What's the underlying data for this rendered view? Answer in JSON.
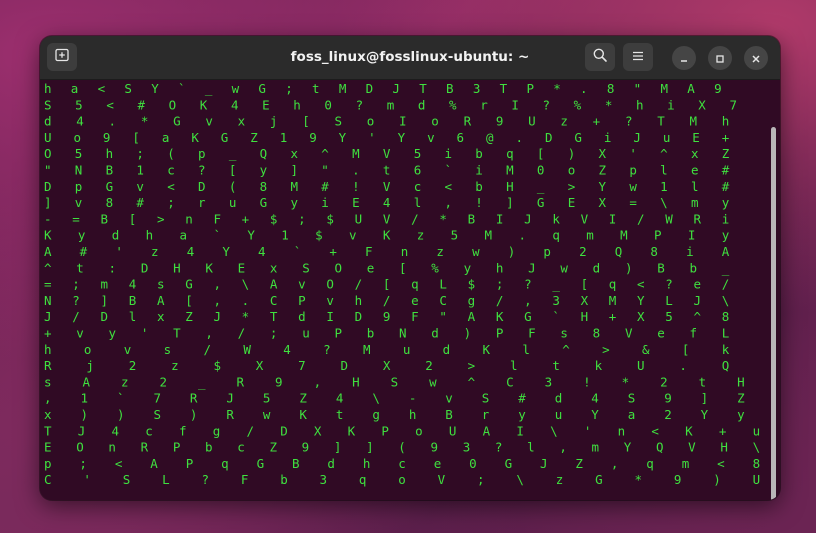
{
  "window": {
    "title": "foss_linux@fosslinux-ubuntu: ~"
  },
  "icons": {
    "new_tab": "new-tab-icon",
    "search": "search-icon",
    "menu": "hamburger-menu-icon",
    "minimize": "minimize-icon",
    "maximize": "maximize-icon",
    "close": "close-icon"
  },
  "colors": {
    "terminal_background": "#300a24",
    "matrix_green": "#3fe03f",
    "titlebar": "#2b2b2b"
  },
  "matrix": {
    "rows": [
      "     h a <   S Y `   _ w G   ; t M D       J T   B     3       T P *     . 8     \" M A 9",
      "     S   5   < # O K   4 E   h 0 ? m           d % r         I     ? %     *       h i X 7",
      "d         4   . * G v   x j   [ S o I         o R 9                 U z     +     ? T M h",
      "U     o   9   [ a K G     Z   1 9 Y '         Y v 6     @           . D     G   i J u E +",
      "O     5   h     ; ( p     _   Q x ^ M         V 5 i     b           q [     )   X ' ^ x Z",
      "\"     N   B     1 c ? [   y   ] \" . t     6       ` i   M           0 o     Z   p   l e #",
      "D     p   G     v < D (   8   M # ! V     c       < b   H     _       >     Y   w   1 l #",
      "]     v         8 # ; r   u   G y i E     4 l     , !   ]     G   E   X     =   \\   m   y",
      "-     =     B   [ > n F   +   $ ; $ U V   / *     B I J   k   V   I   /     W   R       i",
      "K     y     d   h a ` Y       1 $   v     K z     5 M .       q   m   M     P   I       y",
      "A           #   ' z 4 Y       4 `   +     F n     z w )       p 2 Q   8         i       A",
      "^   t       :   D H K E       x S   O e [ %       y h J     w d ) B   b                 _",
      "= ; m   4 s G   ,   \\ A         v   O / [ q L $ ; ?         _ [ q <   ?               e /",
      "N ? ]   B A [   ,   . C         P   v h / e C g /   ,       3 X M Y     L             J \\",
      "J / D   l x     Z   J *         T   d I D 9 F \" A K         G ` H +     X       5     ^ 8",
      "+ v y   ' T         , /         ;   u P   b N   d )         P F s 8     V       e     f L",
      "  h o   v s         / W         4   ? M     u   d             K l ^     >     & [       k",
      "  R j   2 z         $ X             7 D X   2   >               l t     k     U .       Q",
      "  s A   z 2         _ R             9 , H       S w   ^         C 3     !     * 2       t H",
      "  , 1   ` 7         R J   5           Z 4       \\ -   v S       # d     4     S 9     ]   Z",
      "  x )   )   S       ) R   w           K t       g h   B r       y u     Y     a 2     Y   y",
      "  T J   4 c f       g   / D           X K       P o   U A       I \\     '     n <     K   + u",
      "  E O   n R P       b   c Z           9         ] ] ( 9 3       ? l       , m Y Q     V   H \\",
      "  p ;   < A P       q   G B           d         h c e 0 G       J       Z , q         m   < 8",
      "  C '   S L ?           F b           3         q   o V ;       \\       z G *         9   ) U"
    ]
  }
}
